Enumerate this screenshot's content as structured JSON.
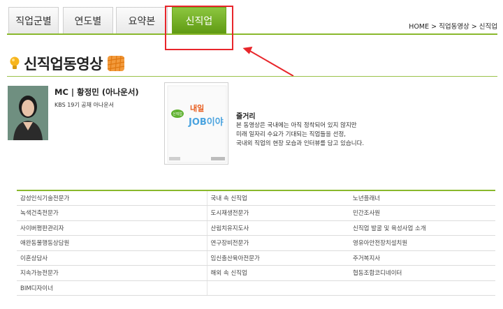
{
  "tabs": [
    {
      "label": "직업군별",
      "active": false
    },
    {
      "label": "연도별",
      "active": false
    },
    {
      "label": "요약본",
      "active": false
    },
    {
      "label": "신직업",
      "active": true
    }
  ],
  "breadcrumb": [
    "HOME",
    "직업동영상",
    "신직업"
  ],
  "breadcrumb_sep": ">",
  "page_title": "신직업동영상",
  "mc": {
    "label": "MC",
    "name": "황정민 (아나운서)",
    "subtitle": "KBS 19기 공채 아나운서"
  },
  "cover": {
    "small_text": "신직업",
    "title": "내일",
    "title2": "JOB이야"
  },
  "synopsis": {
    "title": "줄거리",
    "lines": [
      "본 동영상은 국내에는 아직 정착되어 있지 않지만",
      "미래 일자리 수요가 기대되는 직업들을 선정,",
      "국내외 직업의 현장 모습과 인터뷰를 담고 있습니다."
    ]
  },
  "jobs": [
    [
      "감성인식기술전문가",
      "국내 속 신직업",
      "노년플래너"
    ],
    [
      "녹색건축전문가",
      "도시재생전문가",
      "민간조사원"
    ],
    [
      "사이버평판관리자",
      "산림치유지도사",
      "신직업 발굴 및 육성사업 소개"
    ],
    [
      "애완동물행동상담원",
      "연구장비전문가",
      "영유아안전장치설치원"
    ],
    [
      "이혼상담사",
      "임신출산육아전문가",
      "주거복지사"
    ],
    [
      "지속가능전문가",
      "해외 속 신직업",
      "협동조합코디네이터"
    ],
    [
      "BIM디자이너",
      "",
      ""
    ]
  ],
  "colors": {
    "accent_green": "#8ab82c",
    "tab_active": "#6aa21d",
    "annotation_red": "#e8262b"
  },
  "icons": {
    "title_icon": "lightbulb-icon",
    "title_badge": "orange-pattern-icon",
    "breadcrumb_sep": "chevron-right-icon",
    "annotation": "red-arrow"
  }
}
